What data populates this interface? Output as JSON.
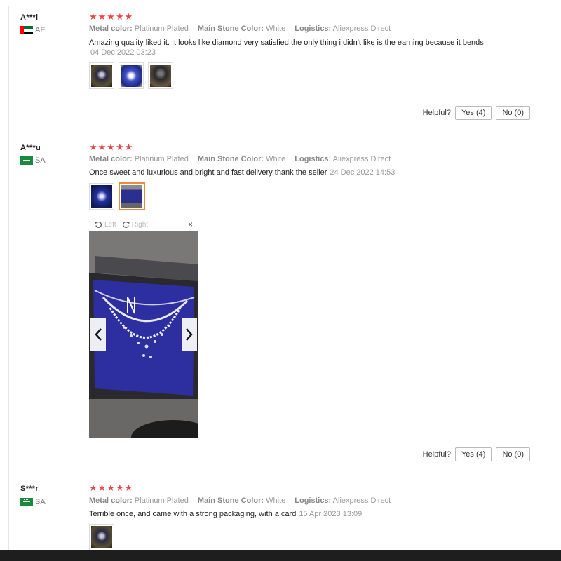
{
  "reviews": [
    {
      "user": "A***i",
      "country": "AE",
      "stars": "★★★★★",
      "meta": {
        "metal_key": "Metal color:",
        "metal_val": "Platinum Plated",
        "stone_key": "Main Stone Color:",
        "stone_val": "White",
        "logistics_key": "Logistics:",
        "logistics_val": "Aliexpress Direct"
      },
      "text": "Amazing quality liked it. It looks like diamond very satisfied the only thing i didn't like is the earning because it bends",
      "date": "04 Dec 2022 03:23",
      "helpful": {
        "label": "Helpful?",
        "yes": "Yes (4)",
        "no": "No (0)"
      }
    },
    {
      "user": "A***u",
      "country": "SA",
      "stars": "★★★★★",
      "meta": {
        "metal_key": "Metal color:",
        "metal_val": "Platinum Plated",
        "stone_key": "Main Stone Color:",
        "stone_val": "White",
        "logistics_key": "Logistics:",
        "logistics_val": "Aliexpress Direct"
      },
      "text": "Once sweet and luxurious and bright and fast delivery thank the seller",
      "date": "24 Dec 2022 14:53",
      "viewer": {
        "left": "Left",
        "right": "Right",
        "close": "×"
      },
      "helpful": {
        "label": "Helpful?",
        "yes": "Yes (4)",
        "no": "No (0)"
      }
    },
    {
      "user": "S***r",
      "country": "SA",
      "stars": "★★★★★",
      "meta": {
        "metal_key": "Metal color:",
        "metal_val": "Platinum Plated",
        "stone_key": "Main Stone Color:",
        "stone_val": "White",
        "logistics_key": "Logistics:",
        "logistics_val": "Aliexpress Direct"
      },
      "text": "Terrible once, and came with a strong packaging, with a card",
      "date": "15 Apr 2023 13:09"
    }
  ],
  "colors": {
    "star": "#e84545",
    "active_thumb": "#f08a33"
  }
}
